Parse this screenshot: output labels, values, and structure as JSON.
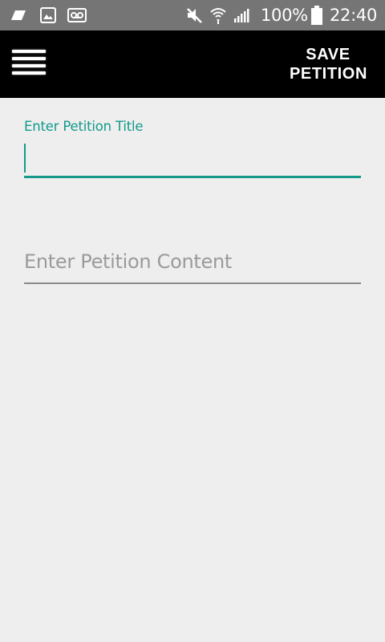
{
  "status_bar": {
    "icons": [
      "notification-icon",
      "image-icon",
      "voicemail-icon",
      "mute-icon",
      "wifi-icon",
      "signal-icon",
      "battery-icon"
    ],
    "battery_percent": "100%",
    "time": "22:40"
  },
  "app_bar": {
    "menu_icon": "hamburger-menu-icon",
    "save_label_line1": "SAVE",
    "save_label_line2": "PETITION",
    "background": "#000000"
  },
  "form": {
    "title_label": "Enter Petition Title",
    "title_value": "",
    "content_placeholder": "Enter Petition Content",
    "content_value": "",
    "accent_color": "#139a8c"
  }
}
